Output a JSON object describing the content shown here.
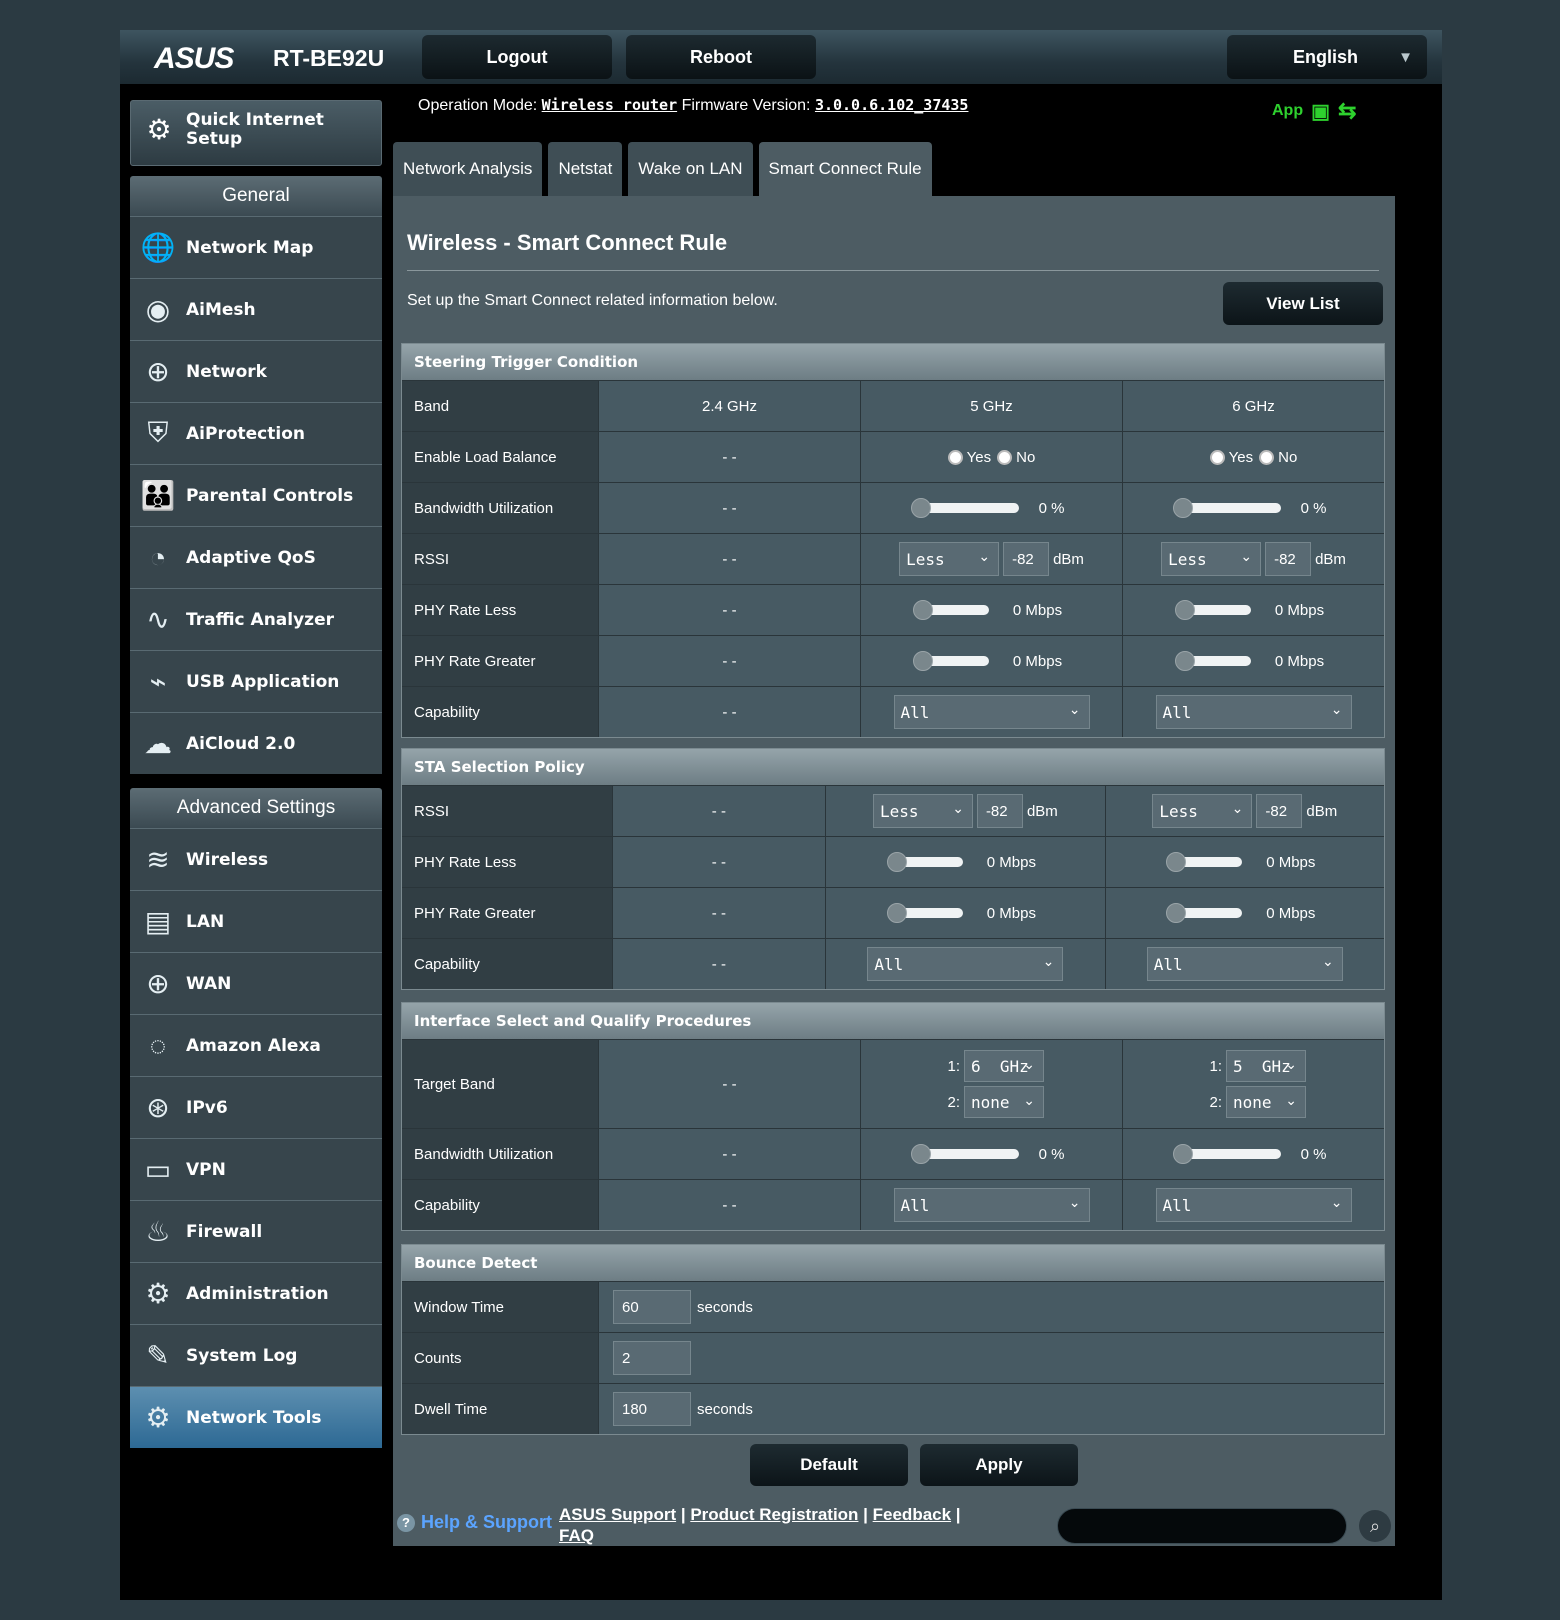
{
  "header": {
    "brand": "ASUS",
    "model": "RT-BE92U",
    "logout": "Logout",
    "reboot": "Reboot",
    "language": "English"
  },
  "op": {
    "op_label": "Operation Mode:",
    "op_value": "Wireless router",
    "fw_label": "Firmware Version:",
    "fw_value": "3.0.0.6.102_37435",
    "app_label": "App"
  },
  "sidebar": {
    "qis": "Quick Internet Setup",
    "general_title": "General",
    "general": [
      {
        "label": "Network Map",
        "icon": "globe-network-icon"
      },
      {
        "label": "AiMesh",
        "icon": "aimesh-icon"
      },
      {
        "label": "Network",
        "icon": "network-icon"
      },
      {
        "label": "AiProtection",
        "icon": "shield-lock-icon"
      },
      {
        "label": "Parental Controls",
        "icon": "family-icon"
      },
      {
        "label": "Adaptive QoS",
        "icon": "gauge-icon"
      },
      {
        "label": "Traffic Analyzer",
        "icon": "pulse-icon"
      },
      {
        "label": "USB Application",
        "icon": "usb-icon"
      },
      {
        "label": "AiCloud 2.0",
        "icon": "cloud-icon"
      }
    ],
    "advanced_title": "Advanced Settings",
    "advanced": [
      {
        "label": "Wireless",
        "icon": "wifi-icon"
      },
      {
        "label": "LAN",
        "icon": "lan-icon"
      },
      {
        "label": "WAN",
        "icon": "wan-globe-icon"
      },
      {
        "label": "Amazon Alexa",
        "icon": "alexa-icon"
      },
      {
        "label": "IPv6",
        "icon": "ipv6-icon"
      },
      {
        "label": "VPN",
        "icon": "vpn-icon"
      },
      {
        "label": "Firewall",
        "icon": "fire-icon"
      },
      {
        "label": "Administration",
        "icon": "admin-gear-icon"
      },
      {
        "label": "System Log",
        "icon": "log-icon"
      },
      {
        "label": "Network Tools",
        "icon": "tools-gear-icon"
      }
    ]
  },
  "tabs": [
    "Network Analysis",
    "Netstat",
    "Wake on LAN",
    "Smart Connect Rule"
  ],
  "main": {
    "title": "Wireless - Smart Connect Rule",
    "desc": "Set up the Smart Connect related information below.",
    "view_list": "View List"
  },
  "steering": {
    "title": "Steering Trigger Condition",
    "band_label": "Band",
    "bands": [
      "2.4 GHz",
      "5 GHz",
      "6 GHz"
    ],
    "load_balance": "Enable Load Balance",
    "yes": "Yes",
    "no": "No",
    "bw_util": "Bandwidth Utilization",
    "bw_5": "0 %",
    "bw_6": "0 %",
    "rssi": "RSSI",
    "rssi_sel": "Less",
    "rssi_val": "-82",
    "dbm": "dBm",
    "phy_less": "PHY Rate Less",
    "phy_greater": "PHY Rate Greater",
    "mbps": "0 Mbps",
    "capability": "Capability",
    "cap_val": "All",
    "na": "- -"
  },
  "sta": {
    "title": "STA Selection Policy",
    "rssi": "RSSI",
    "rssi_sel": "Less",
    "rssi_val": "-82",
    "dbm": "dBm",
    "phy_less": "PHY Rate Less",
    "phy_greater": "PHY Rate Greater",
    "mbps": "0 Mbps",
    "capability": "Capability",
    "cap_val": "All",
    "na": "- -"
  },
  "iface": {
    "title": "Interface Select and Qualify Procedures",
    "target_band": "Target Band",
    "n1": "1:",
    "n2": "2:",
    "t5_1": "6  GHz",
    "t5_2": "none",
    "t6_1": "5  GHz",
    "t6_2": "none",
    "bw_util": "Bandwidth Utilization",
    "bw": "0 %",
    "capability": "Capability",
    "cap_val": "All",
    "na": "- -"
  },
  "bounce": {
    "title": "Bounce Detect",
    "window": "Window Time",
    "window_val": "60",
    "seconds": "seconds",
    "counts": "Counts",
    "counts_val": "2",
    "dwell": "Dwell Time",
    "dwell_val": "180"
  },
  "buttons": {
    "default": "Default",
    "apply": "Apply"
  },
  "footer": {
    "help": "Help & Support",
    "asus_support": "ASUS Support",
    "product_reg": "Product Registration",
    "feedback": "Feedback",
    "faq": "FAQ"
  }
}
